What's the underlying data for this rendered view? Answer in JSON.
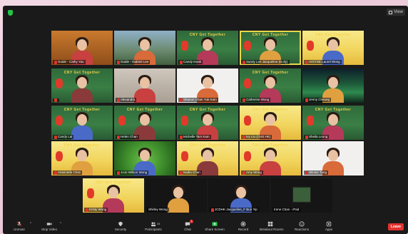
{
  "window": {
    "view_label": "View"
  },
  "participants": [
    {
      "name": "Guide - Cathy Yau",
      "muted": true,
      "bg": "bg-orange"
    },
    {
      "name": "Guide - Gabriel Lee",
      "muted": true,
      "bg": "bg-outdoor"
    },
    {
      "name": "Candy Kwok",
      "muted": true,
      "bg": "bg-green"
    },
    {
      "name": "Sandy Lee Jacqueline (Dolly)",
      "muted": true,
      "bg": "bg-green"
    },
    {
      "name": "ArGYSE Laurel Wong",
      "muted": true,
      "bg": "bg-yellow"
    },
    {
      "name": "",
      "muted": true,
      "bg": "bg-green"
    },
    {
      "name": "Alexandra",
      "muted": true,
      "bg": "bg-room"
    },
    {
      "name": "Shanon Chan Yuk Kam",
      "muted": true,
      "bg": "bg-white"
    },
    {
      "name": "Catherine Wong",
      "muted": true,
      "bg": "bg-green"
    },
    {
      "name": "Jenny Cheung",
      "muted": true,
      "bg": "bg-aurora"
    },
    {
      "name": "Candy Lai",
      "muted": true,
      "bg": "bg-green"
    },
    {
      "name": "Helen Chan",
      "muted": true,
      "bg": "bg-green"
    },
    {
      "name": "Michelle Tam Kam",
      "muted": true,
      "bg": "bg-green"
    },
    {
      "name": "Ivy Liu (CHS HK)",
      "muted": true,
      "bg": "bg-yellow"
    },
    {
      "name": "Sheila Leung",
      "muted": true,
      "bg": "bg-green"
    },
    {
      "name": "Antoinette Chan",
      "muted": true,
      "bg": "bg-yellow"
    },
    {
      "name": "JoJo Wilson Wong",
      "muted": true,
      "bg": "bg-leaf"
    },
    {
      "name": "Nadia Chan",
      "muted": true,
      "bg": "bg-yellow"
    },
    {
      "name": "Amy Wong",
      "muted": true,
      "bg": "bg-yellow"
    },
    {
      "name": "Winnie Tung",
      "muted": true,
      "bg": "bg-white"
    },
    {
      "name": "Kristy Wong",
      "muted": true,
      "bg": "bg-yellow"
    },
    {
      "name": "Shirley Wong",
      "muted": false,
      "bg": "bg-dark"
    },
    {
      "name": "JCDHK Jacqueline_F Bun Yip",
      "muted": true,
      "bg": "bg-dark"
    },
    {
      "name": "Irene Chan - iPad",
      "muted": false,
      "bg": "bg-dark"
    }
  ],
  "banner_text": "CNY Get Together",
  "toolbar": {
    "unmute": "Unmute",
    "stop_video": "Stop Video",
    "security": "Security",
    "participants": "Participants",
    "participants_count": "24",
    "chat": "Chat",
    "chat_badge": "1",
    "share_screen": "Share Screen",
    "record": "Record",
    "breakout_rooms": "Breakout Rooms",
    "reactions": "Reactions",
    "apps": "Apps",
    "leave": "Leave"
  },
  "colors": {
    "muted_icon": "#e0322e",
    "share_screen": "#23c447",
    "leave": "#e0322e",
    "speaker_outline": "#e8d84a"
  }
}
